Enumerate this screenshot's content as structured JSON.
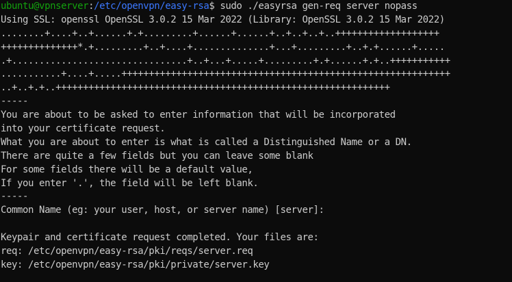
{
  "terminal": {
    "prompt": {
      "user_host": "ubuntu@vpnserver",
      "separator": ":",
      "path": "/etc/openvpn/easy-rsa",
      "symbol": "$",
      "command": " sudo ./easyrsa gen-req server nopass"
    },
    "lines": [
      "Using SSL: openssl OpenSSL 3.0.2 15 Mar 2022 (Library: OpenSSL 3.0.2 15 Mar 2022)",
      "........+....+..+......+.+.........+......+......+..+..+..+..+++++++++++++++++++",
      "++++++++++++++*.+.........+..+....+..............+...+.........+..+.+......+.....",
      ".+................................+..+...+.....+.........+.+......+.+..+++++++++++",
      "...........+....+.....++++++++++++++++++++++++++++++++++++++++++++++++++++++++++++",
      "..+..+.+..+++++++++++++++++++++++++++++++++++++++++++++++++++++++++++++",
      "-----",
      "You are about to be asked to enter information that will be incorporated",
      "into your certificate request.",
      "What you are about to enter is what is called a Distinguished Name or a DN.",
      "There are quite a few fields but you can leave some blank",
      "For some fields there will be a default value,",
      "If you enter '.', the field will be left blank.",
      "-----",
      "Common Name (eg: your user, host, or server name) [server]:",
      "",
      "Keypair and certificate request completed. Your files are:",
      "req: /etc/openvpn/easy-rsa/pki/reqs/server.req",
      "key: /etc/openvpn/easy-rsa/pki/private/server.key"
    ]
  },
  "colors": {
    "background": "#0c0c0c",
    "foreground": "#cccccc",
    "prompt_user": "#13a10e",
    "prompt_path": "#3b78ff"
  }
}
